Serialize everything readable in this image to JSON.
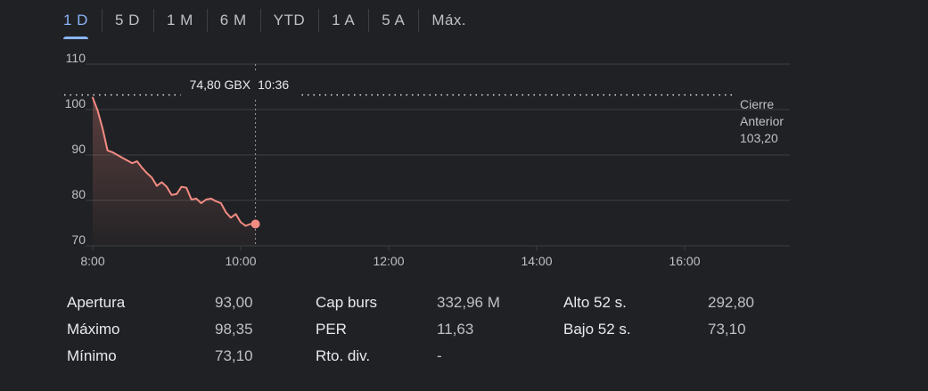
{
  "tabs": [
    {
      "label": "1 D",
      "active": true
    },
    {
      "label": "5 D",
      "active": false
    },
    {
      "label": "1 M",
      "active": false
    },
    {
      "label": "6 M",
      "active": false
    },
    {
      "label": "YTD",
      "active": false
    },
    {
      "label": "1 A",
      "active": false
    },
    {
      "label": "5 A",
      "active": false
    },
    {
      "label": "Máx.",
      "active": false
    }
  ],
  "chart_data": {
    "type": "area",
    "currency": "GBX",
    "x_unit": "time",
    "x_ticks": [
      "8:00",
      "10:00",
      "12:00",
      "14:00",
      "16:00"
    ],
    "x_range": [
      "8:00",
      "17:20"
    ],
    "y_ticks": [
      70,
      80,
      90,
      100,
      110
    ],
    "ylim": [
      70,
      110
    ],
    "series": [
      {
        "times": [
          "8:00",
          "8:04",
          "8:08",
          "8:12",
          "8:16",
          "8:20",
          "8:24",
          "8:28",
          "8:32",
          "8:36",
          "8:40",
          "8:44",
          "8:48",
          "8:52",
          "8:56",
          "9:00",
          "9:04",
          "9:08",
          "9:12",
          "9:16",
          "9:20",
          "9:24",
          "9:28",
          "9:32",
          "9:36",
          "9:40",
          "9:44",
          "9:48",
          "9:52",
          "9:56",
          "10:00",
          "10:04",
          "10:08",
          "10:12",
          "10:16",
          "10:20",
          "10:24",
          "10:28",
          "10:32",
          "10:36"
        ],
        "values": [
          102.6,
          99.8,
          95.8,
          91.0,
          90.6,
          90.0,
          89.4,
          88.8,
          88.2,
          88.6,
          87.2,
          86.0,
          85.0,
          83.2,
          84.0,
          83.0,
          81.2,
          81.4,
          83.0,
          82.8,
          80.2,
          80.4,
          79.4,
          80.2,
          80.4,
          79.8,
          79.4,
          77.4,
          76.2,
          77.0,
          75.2,
          74.4,
          74.8,
          74.8
        ],
        "color": "#f28b82"
      }
    ],
    "reference_line": {
      "label_line1": "Cierre",
      "label_line2": "Anterior",
      "value_text": "103,20",
      "value": 103.2
    },
    "tooltip": {
      "price": "74,80 GBX",
      "time": "10:36"
    },
    "grid": true,
    "color_line": "#f28b82",
    "color_grid": "#3c4043",
    "color_reference": "#e8eaed"
  },
  "stats": [
    {
      "label": "Apertura",
      "value": "93,00"
    },
    {
      "label": "Máximo",
      "value": "98,35"
    },
    {
      "label": "Mínimo",
      "value": "73,10"
    },
    {
      "label": "Cap burs",
      "value": "332,96 M"
    },
    {
      "label": "PER",
      "value": "11,63"
    },
    {
      "label": "Rto. div.",
      "value": "-"
    },
    {
      "label": "Alto 52 s.",
      "value": "292,80"
    },
    {
      "label": "Bajo 52 s.",
      "value": "73,10"
    }
  ]
}
